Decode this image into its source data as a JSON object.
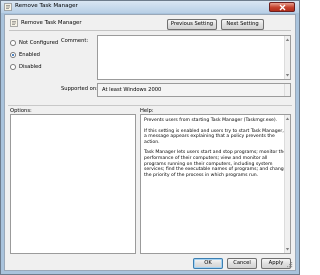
{
  "window": {
    "title": "Remove Task Manager"
  },
  "header": {
    "setting_name": "Remove Task Manager",
    "previous_button": "Previous Setting",
    "next_button": "Next Setting"
  },
  "state": {
    "options": [
      {
        "label": "Not Configured",
        "checked": false
      },
      {
        "label": "Enabled",
        "checked": true
      },
      {
        "label": "Disabled",
        "checked": false
      }
    ]
  },
  "comment": {
    "label": "Comment:",
    "value": ""
  },
  "supported": {
    "label": "Supported on:",
    "value": "At least Windows 2000"
  },
  "options_panel": {
    "label": "Options:"
  },
  "help_panel": {
    "label": "Help:",
    "paragraphs": [
      "Prevents users from starting Task Manager (Taskmgr.exe).",
      "If this setting is enabled and users try to start Task Manager, a message appears explaining that a policy prevents the action.",
      "Task Manager lets users start and stop programs; monitor the performance of their computers; view and monitor all programs running on their computers, including system services; find the executable names of programs; and change the priority of the process in which programs run."
    ]
  },
  "footer": {
    "ok": "OK",
    "cancel": "Cancel",
    "apply": "Apply"
  }
}
